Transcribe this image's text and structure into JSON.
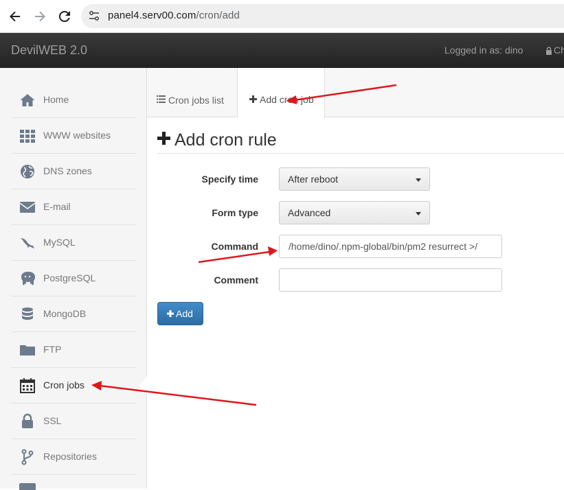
{
  "browser": {
    "url_host": "panel4.serv00.com",
    "url_path": "/cron/add",
    "back_icon": "arrow-left-icon",
    "forward_icon": "arrow-right-icon",
    "reload_icon": "reload-icon"
  },
  "header": {
    "brand_prefix": "Devil",
    "brand_bold": "WEB",
    "brand_version": " 2.0",
    "logged_in": "Logged in as: dino",
    "cut_text": "Ch"
  },
  "sidebar": {
    "items": [
      {
        "label": "Home",
        "icon": "home-icon"
      },
      {
        "label": "WWW websites",
        "icon": "grid-icon"
      },
      {
        "label": "DNS zones",
        "icon": "globe-icon"
      },
      {
        "label": "E-mail",
        "icon": "envelope-icon"
      },
      {
        "label": "MySQL",
        "icon": "dolphin-icon"
      },
      {
        "label": "PostgreSQL",
        "icon": "elephant-icon"
      },
      {
        "label": "MongoDB",
        "icon": "database-icon"
      },
      {
        "label": "FTP",
        "icon": "folder-icon"
      },
      {
        "label": "Cron jobs",
        "icon": "calendar-icon",
        "active": true
      },
      {
        "label": "SSL",
        "icon": "lock-icon"
      },
      {
        "label": "Repositories",
        "icon": "branch-icon"
      }
    ]
  },
  "tabs": [
    {
      "label": "Cron jobs list",
      "icon": "list-icon"
    },
    {
      "label": "Add cron job",
      "icon": "plus-icon",
      "active": true
    }
  ],
  "form": {
    "title": "Add cron rule",
    "specify_time_label": "Specify time",
    "specify_time_value": "After reboot",
    "form_type_label": "Form type",
    "form_type_value": "Advanced",
    "command_label": "Command",
    "command_value": "/home/dino/.npm-global/bin/pm2 resurrect >/",
    "comment_label": "Comment",
    "comment_value": "",
    "add_button": "Add"
  },
  "colors": {
    "primary": "#428bca",
    "annotation": "#e0161b",
    "navbar": "#222222",
    "icon": "#6d7b8c"
  }
}
